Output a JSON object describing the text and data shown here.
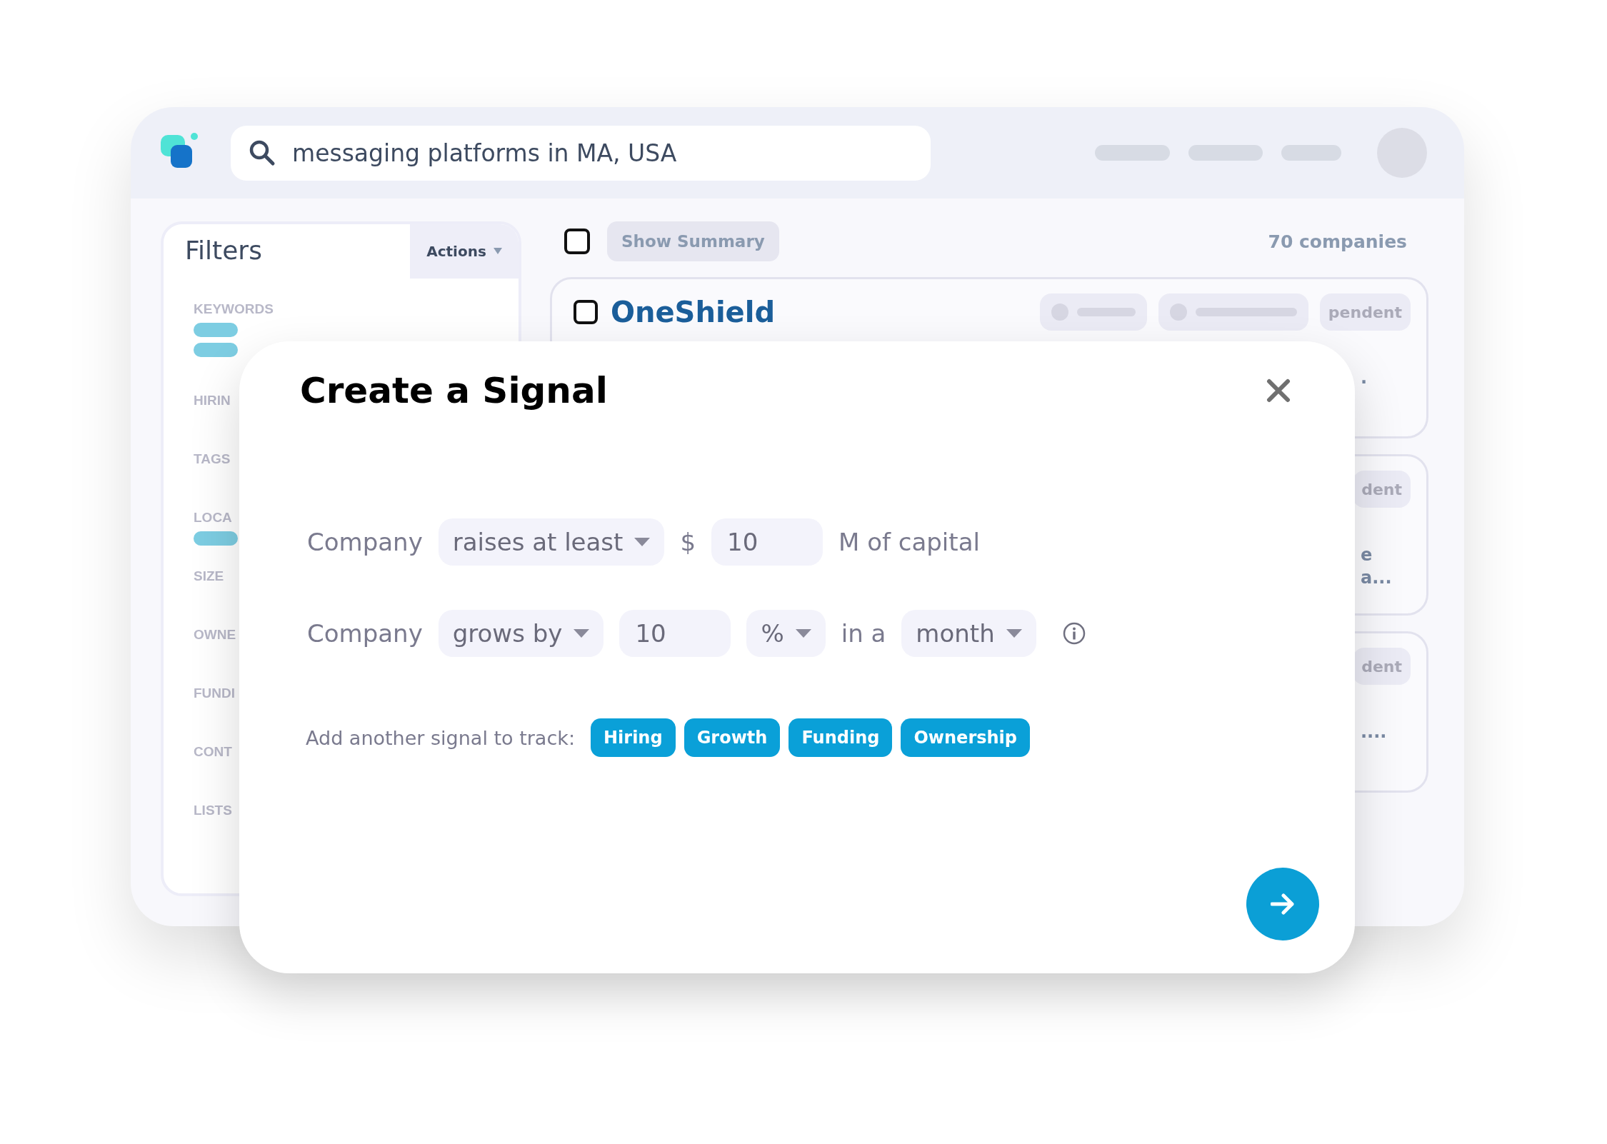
{
  "search": {
    "value": "messaging platforms in MA, USA"
  },
  "filters": {
    "title": "Filters",
    "actions": "Actions",
    "sections": [
      {
        "label": "KEYWORDS",
        "kind": "two_bars"
      },
      {
        "label": "HIRIN",
        "kind": "plain"
      },
      {
        "label": "TAGS",
        "kind": "plain"
      },
      {
        "label": "LOCA",
        "kind": "one_bar"
      },
      {
        "label": "SIZE",
        "kind": "plain"
      },
      {
        "label": "OWNE",
        "kind": "plain"
      },
      {
        "label": "FUNDI",
        "kind": "plain"
      },
      {
        "label": "CONT",
        "kind": "plain"
      },
      {
        "label": "LISTS",
        "kind": "plain"
      }
    ]
  },
  "results": {
    "select_all": {
      "checked": false
    },
    "summary_button": "Show Summary",
    "count": "70 companies",
    "cards": [
      {
        "title": "OneShield",
        "checked": false,
        "chips": [
          {
            "kind": "blank"
          },
          {
            "kind": "blank"
          },
          {
            "kind": "text",
            "text": "pendent"
          }
        ],
        "fragments": [
          "."
        ]
      },
      {
        "chips": [
          {
            "kind": "text",
            "text": "dent"
          }
        ],
        "fragments": [
          "e",
          "a..."
        ]
      },
      {
        "chips": [
          {
            "kind": "text",
            "text": "dent"
          }
        ],
        "fragments": [
          "...."
        ]
      }
    ]
  },
  "modal": {
    "title": "Create a Signal",
    "rows": [
      {
        "items": [
          {
            "kind": "label",
            "text": "Company"
          },
          {
            "kind": "dropdown",
            "value": "raises at least"
          },
          {
            "kind": "label",
            "text": "$"
          },
          {
            "kind": "input",
            "value": "10"
          },
          {
            "kind": "label",
            "text": "M of capital"
          }
        ]
      },
      {
        "items": [
          {
            "kind": "label",
            "text": "Company"
          },
          {
            "kind": "dropdown",
            "value": "grows by"
          },
          {
            "kind": "input",
            "value": "10"
          },
          {
            "kind": "dropdown",
            "value": "%"
          },
          {
            "kind": "label",
            "text": "in a"
          },
          {
            "kind": "dropdown",
            "value": "month"
          },
          {
            "kind": "info"
          }
        ]
      }
    ],
    "add_prompt": "Add another signal to track:",
    "signal_tags": [
      "Hiring",
      "Growth",
      "Funding",
      "Ownership"
    ]
  }
}
